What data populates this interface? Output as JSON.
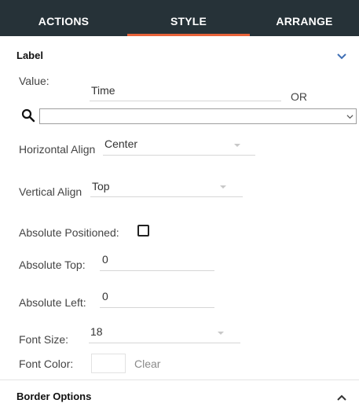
{
  "tabs": {
    "actions": "ACTIONS",
    "style": "STYLE",
    "arrange": "ARRANGE"
  },
  "label_section": {
    "title": "Label",
    "value_label": "Value:",
    "value": "Time",
    "or_text": "OR",
    "search_value": "",
    "horizontal_align_label": "Horizontal Align",
    "horizontal_align_value": "Center",
    "vertical_align_label": "Vertical Align",
    "vertical_align_value": "Top",
    "absolute_positioned_label": "Absolute Positioned:",
    "absolute_positioned_checked": false,
    "absolute_top_label": "Absolute Top:",
    "absolute_top_value": "0",
    "absolute_left_label": "Absolute Left:",
    "absolute_left_value": "0",
    "font_size_label": "Font Size:",
    "font_size_value": "18",
    "font_color_label": "Font Color:",
    "font_color_value": "#ffffff",
    "clear_label": "Clear"
  },
  "border_section": {
    "title": "Border Options"
  },
  "icons": {
    "label_chevron": "chevron-down-icon",
    "border_chevron": "chevron-up-icon",
    "search": "search-icon",
    "dropdown": "chevron-down-icon"
  },
  "colors": {
    "tab_bar": "#263238",
    "tab_indicator": "#e8633a",
    "chevron": "#3f6fb5"
  }
}
